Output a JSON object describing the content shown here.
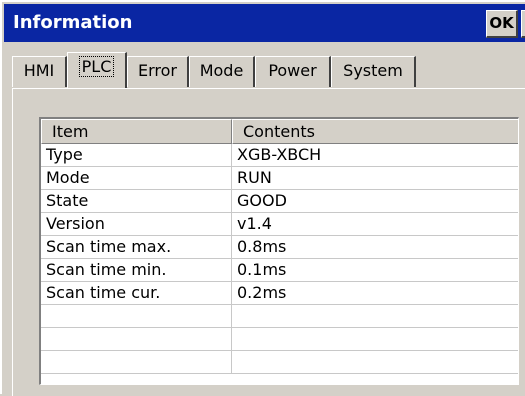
{
  "window": {
    "title": "Information",
    "ok_label": "OK",
    "close_label": "✕"
  },
  "tabs": [
    {
      "label": "HMI",
      "active": false
    },
    {
      "label": "PLC",
      "active": true
    },
    {
      "label": "Error",
      "active": false
    },
    {
      "label": "Mode",
      "active": false
    },
    {
      "label": "Power",
      "active": false
    },
    {
      "label": "System",
      "active": false
    }
  ],
  "table": {
    "headers": [
      "Item",
      "Contents"
    ],
    "rows": [
      [
        "Type",
        "XGB-XBCH"
      ],
      [
        "Mode",
        "RUN"
      ],
      [
        "State",
        "GOOD"
      ],
      [
        "Version",
        "v1.4"
      ],
      [
        "Scan time max.",
        "0.8ms"
      ],
      [
        "Scan time min.",
        "0.1ms"
      ],
      [
        "Scan time cur.",
        "0.2ms"
      ],
      [
        "",
        ""
      ],
      [
        "",
        ""
      ],
      [
        "",
        ""
      ]
    ]
  }
}
